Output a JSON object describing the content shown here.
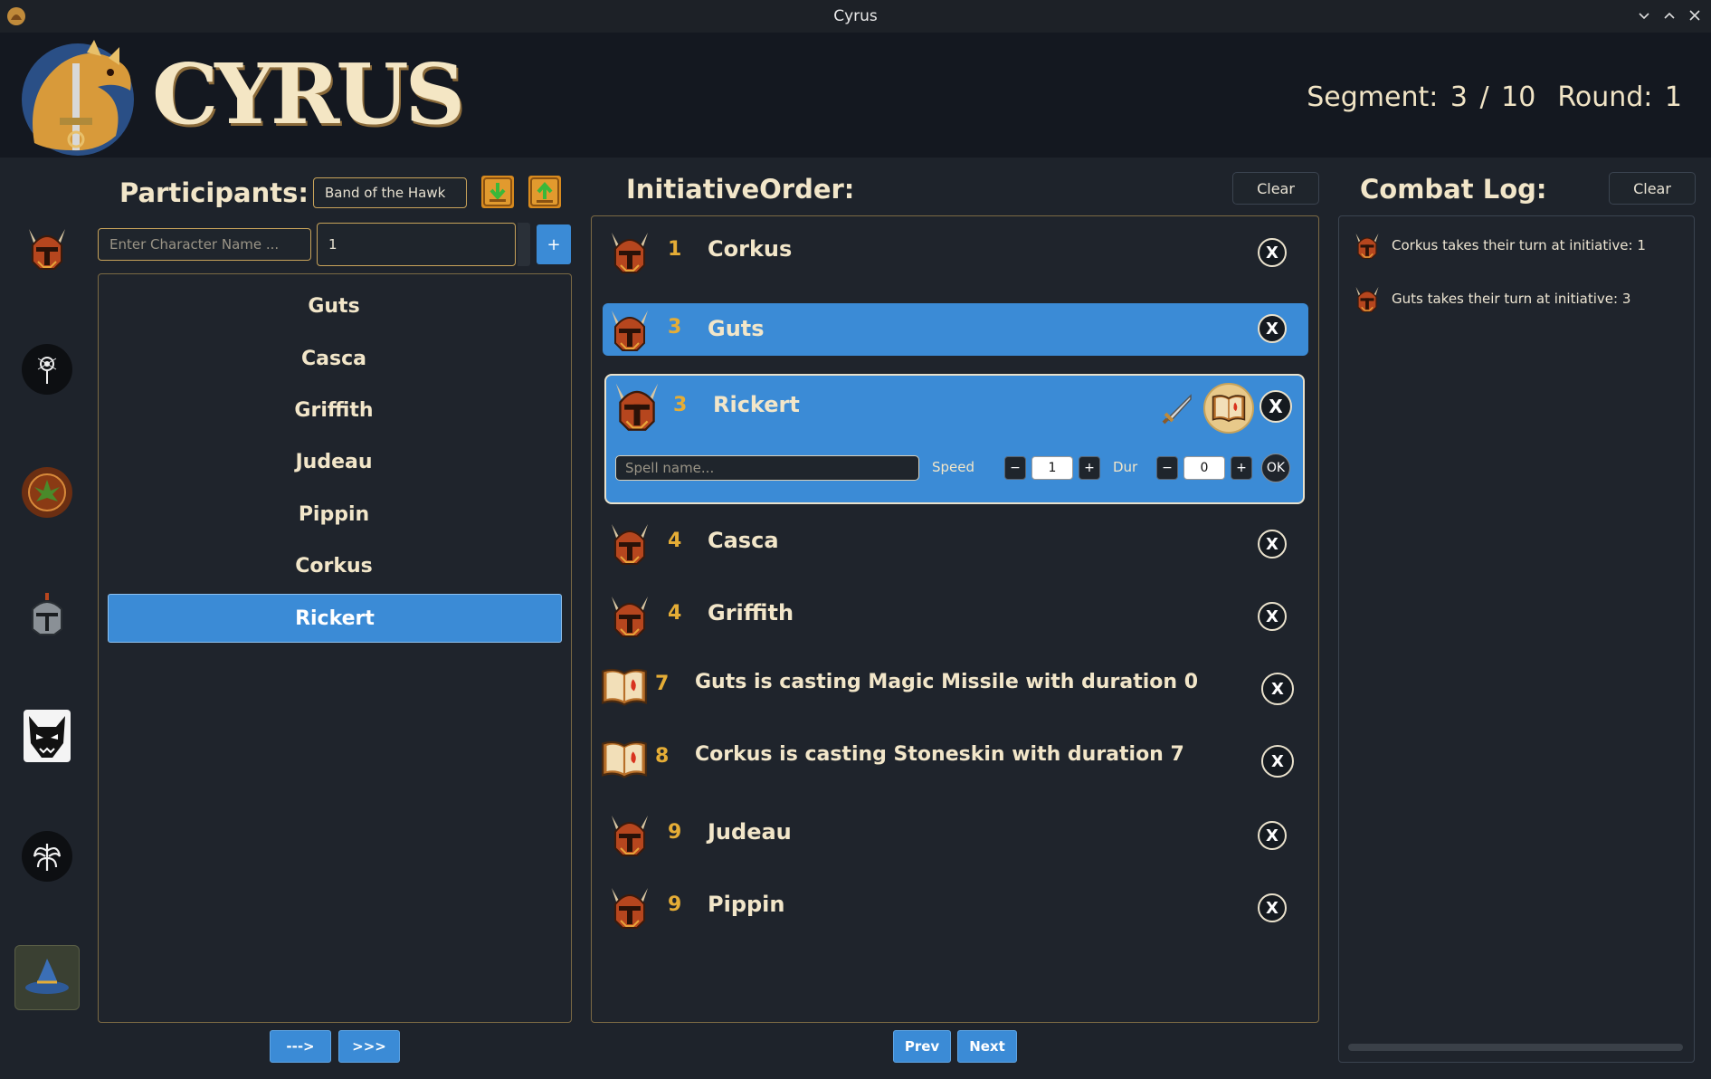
{
  "window": {
    "title": "Cyrus"
  },
  "header": {
    "logo_text": "CYRUS",
    "segment": "Segment: 3 / 10",
    "round": "Round: 1"
  },
  "participants": {
    "title": "Participants:",
    "group_name": "Band of the Hawk",
    "name_placeholder": "Enter Character Name ...",
    "initiative_value": "1",
    "add_label": "+",
    "items": [
      "Guts",
      "Casca",
      "Griffith",
      "Judeau",
      "Pippin",
      "Corkus",
      "Rickert"
    ],
    "selected": "Rickert",
    "move_one_label": "--->",
    "move_all_label": ">>>"
  },
  "initiative": {
    "title": "InitiativeOrder:",
    "clear_label": "Clear",
    "close_label": "X",
    "rows": [
      {
        "num": "1",
        "name": "Corkus"
      },
      {
        "num": "3",
        "name": "Guts"
      },
      {
        "num": "3",
        "name": "Rickert"
      },
      {
        "num": "4",
        "name": "Casca"
      },
      {
        "num": "4",
        "name": "Griffith"
      },
      {
        "num": "7",
        "name": "Guts is casting Magic Missile with duration 0"
      },
      {
        "num": "8",
        "name": "Corkus is casting Stoneskin with duration 7"
      },
      {
        "num": "9",
        "name": "Judeau"
      },
      {
        "num": "9",
        "name": "Pippin"
      }
    ],
    "spell_form": {
      "spell_placeholder": "Spell name...",
      "speed_label": "Speed",
      "speed_value": "1",
      "dur_label": "Dur",
      "dur_value": "0",
      "minus": "−",
      "plus": "+",
      "ok_label": "OK"
    },
    "prev_label": "Prev",
    "next_label": "Next"
  },
  "combat_log": {
    "title": "Combat Log:",
    "clear_label": "Clear",
    "entries": [
      "Corkus takes their turn at initiative: 1",
      "Guts takes their turn at initiative: 3"
    ]
  },
  "colors": {
    "accent": "#3b8bd6",
    "gold": "#e5ad36",
    "cream": "#f2e6c9",
    "background": "#1e232b"
  }
}
